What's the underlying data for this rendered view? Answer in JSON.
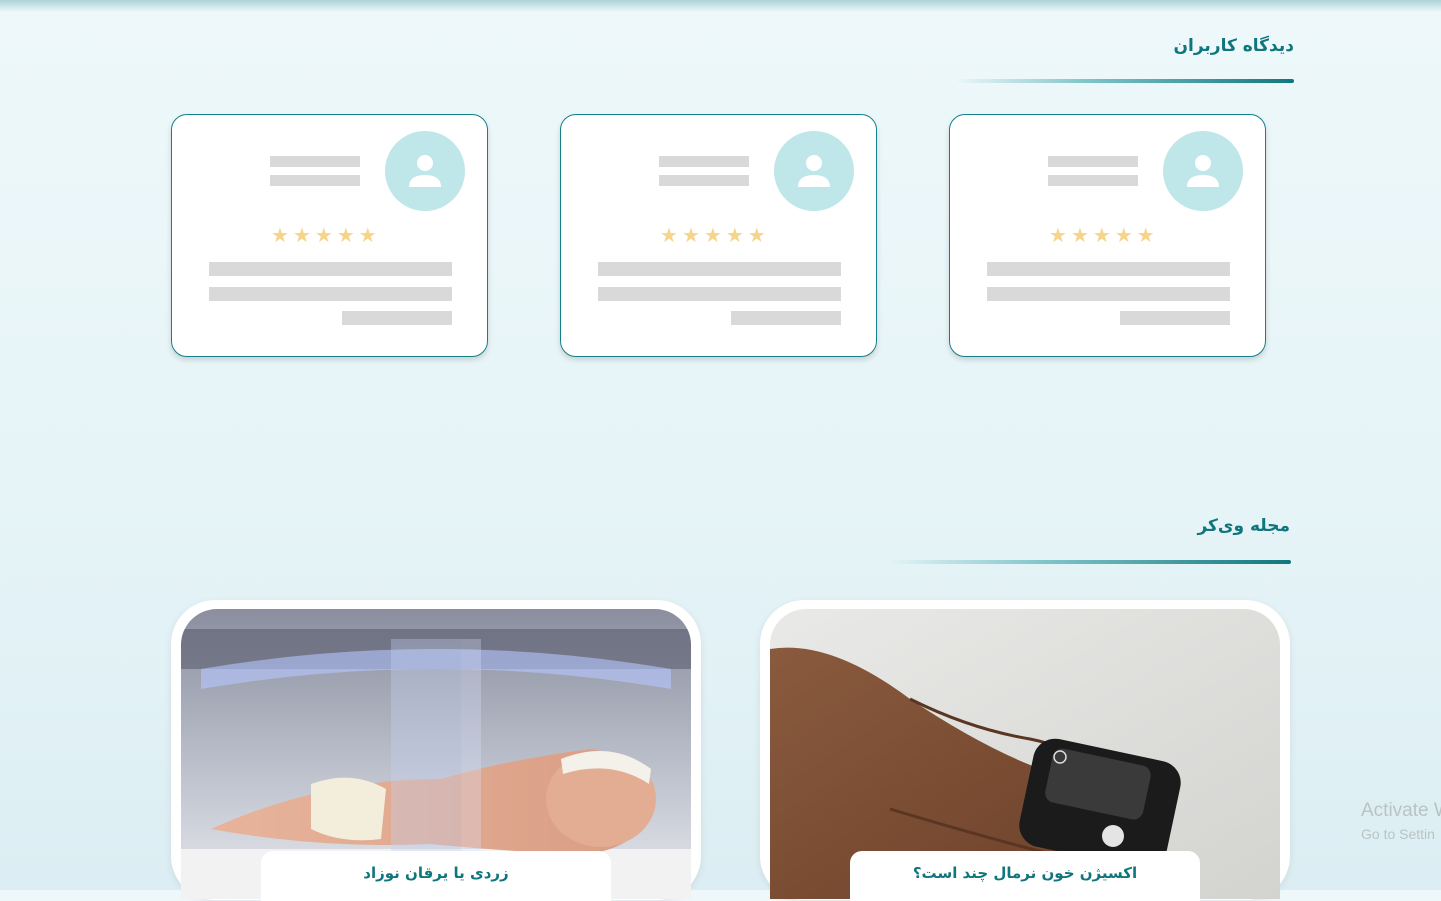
{
  "reviews": {
    "title": "دیدگاه کاربران",
    "cards": [
      {
        "rating": 5,
        "star": "★"
      },
      {
        "rating": 5,
        "star": "★"
      },
      {
        "rating": 5,
        "star": "★"
      }
    ]
  },
  "magazine": {
    "title": "مجله وی‌کر",
    "articles": [
      {
        "title": "اکسیژن خون نرمال چند است؟",
        "image": "pulse-oximeter-finger-photo"
      },
      {
        "title": "زردی یا یرقان نوزاد",
        "image": "newborn-incubator-phototherapy-photo"
      }
    ]
  },
  "watermark": {
    "line1": "Activate W",
    "line2": "Go to Settin"
  },
  "colors": {
    "accent": "#10767d",
    "avatar_bg": "#bfe6e8",
    "star": "#f6d48a",
    "placeholder": "#d9d9d9"
  }
}
